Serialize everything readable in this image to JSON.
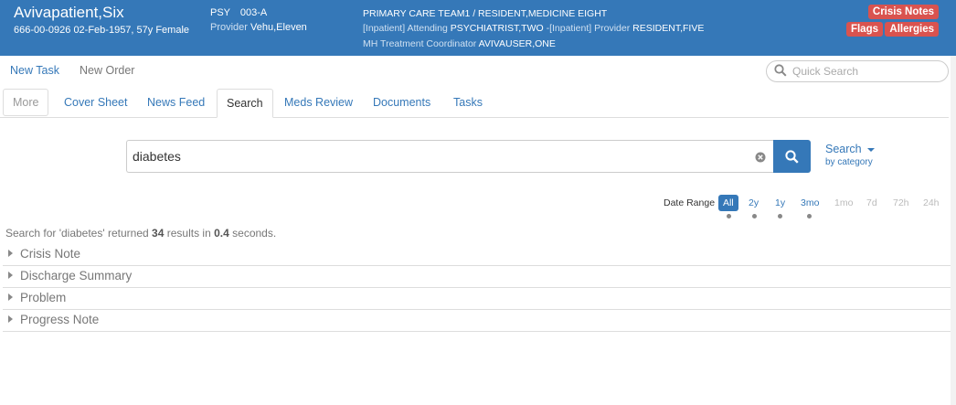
{
  "header": {
    "patient_name": "Avivapatient,Six",
    "demographics": "666-00-0926 02-Feb-1957, 57y Female",
    "ward": "PSY",
    "room": "003-A",
    "provider_label": "Provider",
    "provider_name": "Vehu,Eleven",
    "care_team": "PRIMARY CARE TEAM1 / RESIDENT,MEDICINE EIGHT",
    "attending_label": "[Inpatient] Attending",
    "attending_name": "PSYCHIATRIST,TWO",
    "inpatient_provider_label": "-[Inpatient] Provider",
    "inpatient_provider_name": "RESIDENT,FIVE",
    "mh_label": "MH Treatment Coordinator",
    "mh_name": "AVIVAUSER,ONE",
    "badges": {
      "crisis_notes": "Crisis Notes",
      "flags": "Flags",
      "allergies": "Allergies"
    }
  },
  "toolbar": {
    "new_task": "New Task",
    "new_order": "New Order",
    "quick_search_placeholder": "Quick Search"
  },
  "tabs": [
    {
      "label": "More"
    },
    {
      "label": "Cover Sheet"
    },
    {
      "label": "News Feed"
    },
    {
      "label": "Search"
    },
    {
      "label": "Meds Review"
    },
    {
      "label": "Documents"
    },
    {
      "label": "Tasks"
    }
  ],
  "search": {
    "query": "diabetes",
    "button_label": "Search",
    "category_sub": "by category"
  },
  "date_range": {
    "label": "Date Range",
    "options": [
      "All",
      "2y",
      "1y",
      "3mo",
      "1mo",
      "7d",
      "72h",
      "24h"
    ],
    "selected": "All"
  },
  "results": {
    "summary_prefix": "Search for 'diabetes' returned",
    "count": "34",
    "summary_mid": "results in",
    "seconds": "0.4",
    "summary_suffix": "seconds.",
    "categories": [
      "Crisis Note",
      "Discharge Summary",
      "Problem",
      "Progress Note"
    ]
  },
  "colors": {
    "header_bg": "#3578b8",
    "badge_red": "#d9534f",
    "link_blue": "#3578b8"
  }
}
